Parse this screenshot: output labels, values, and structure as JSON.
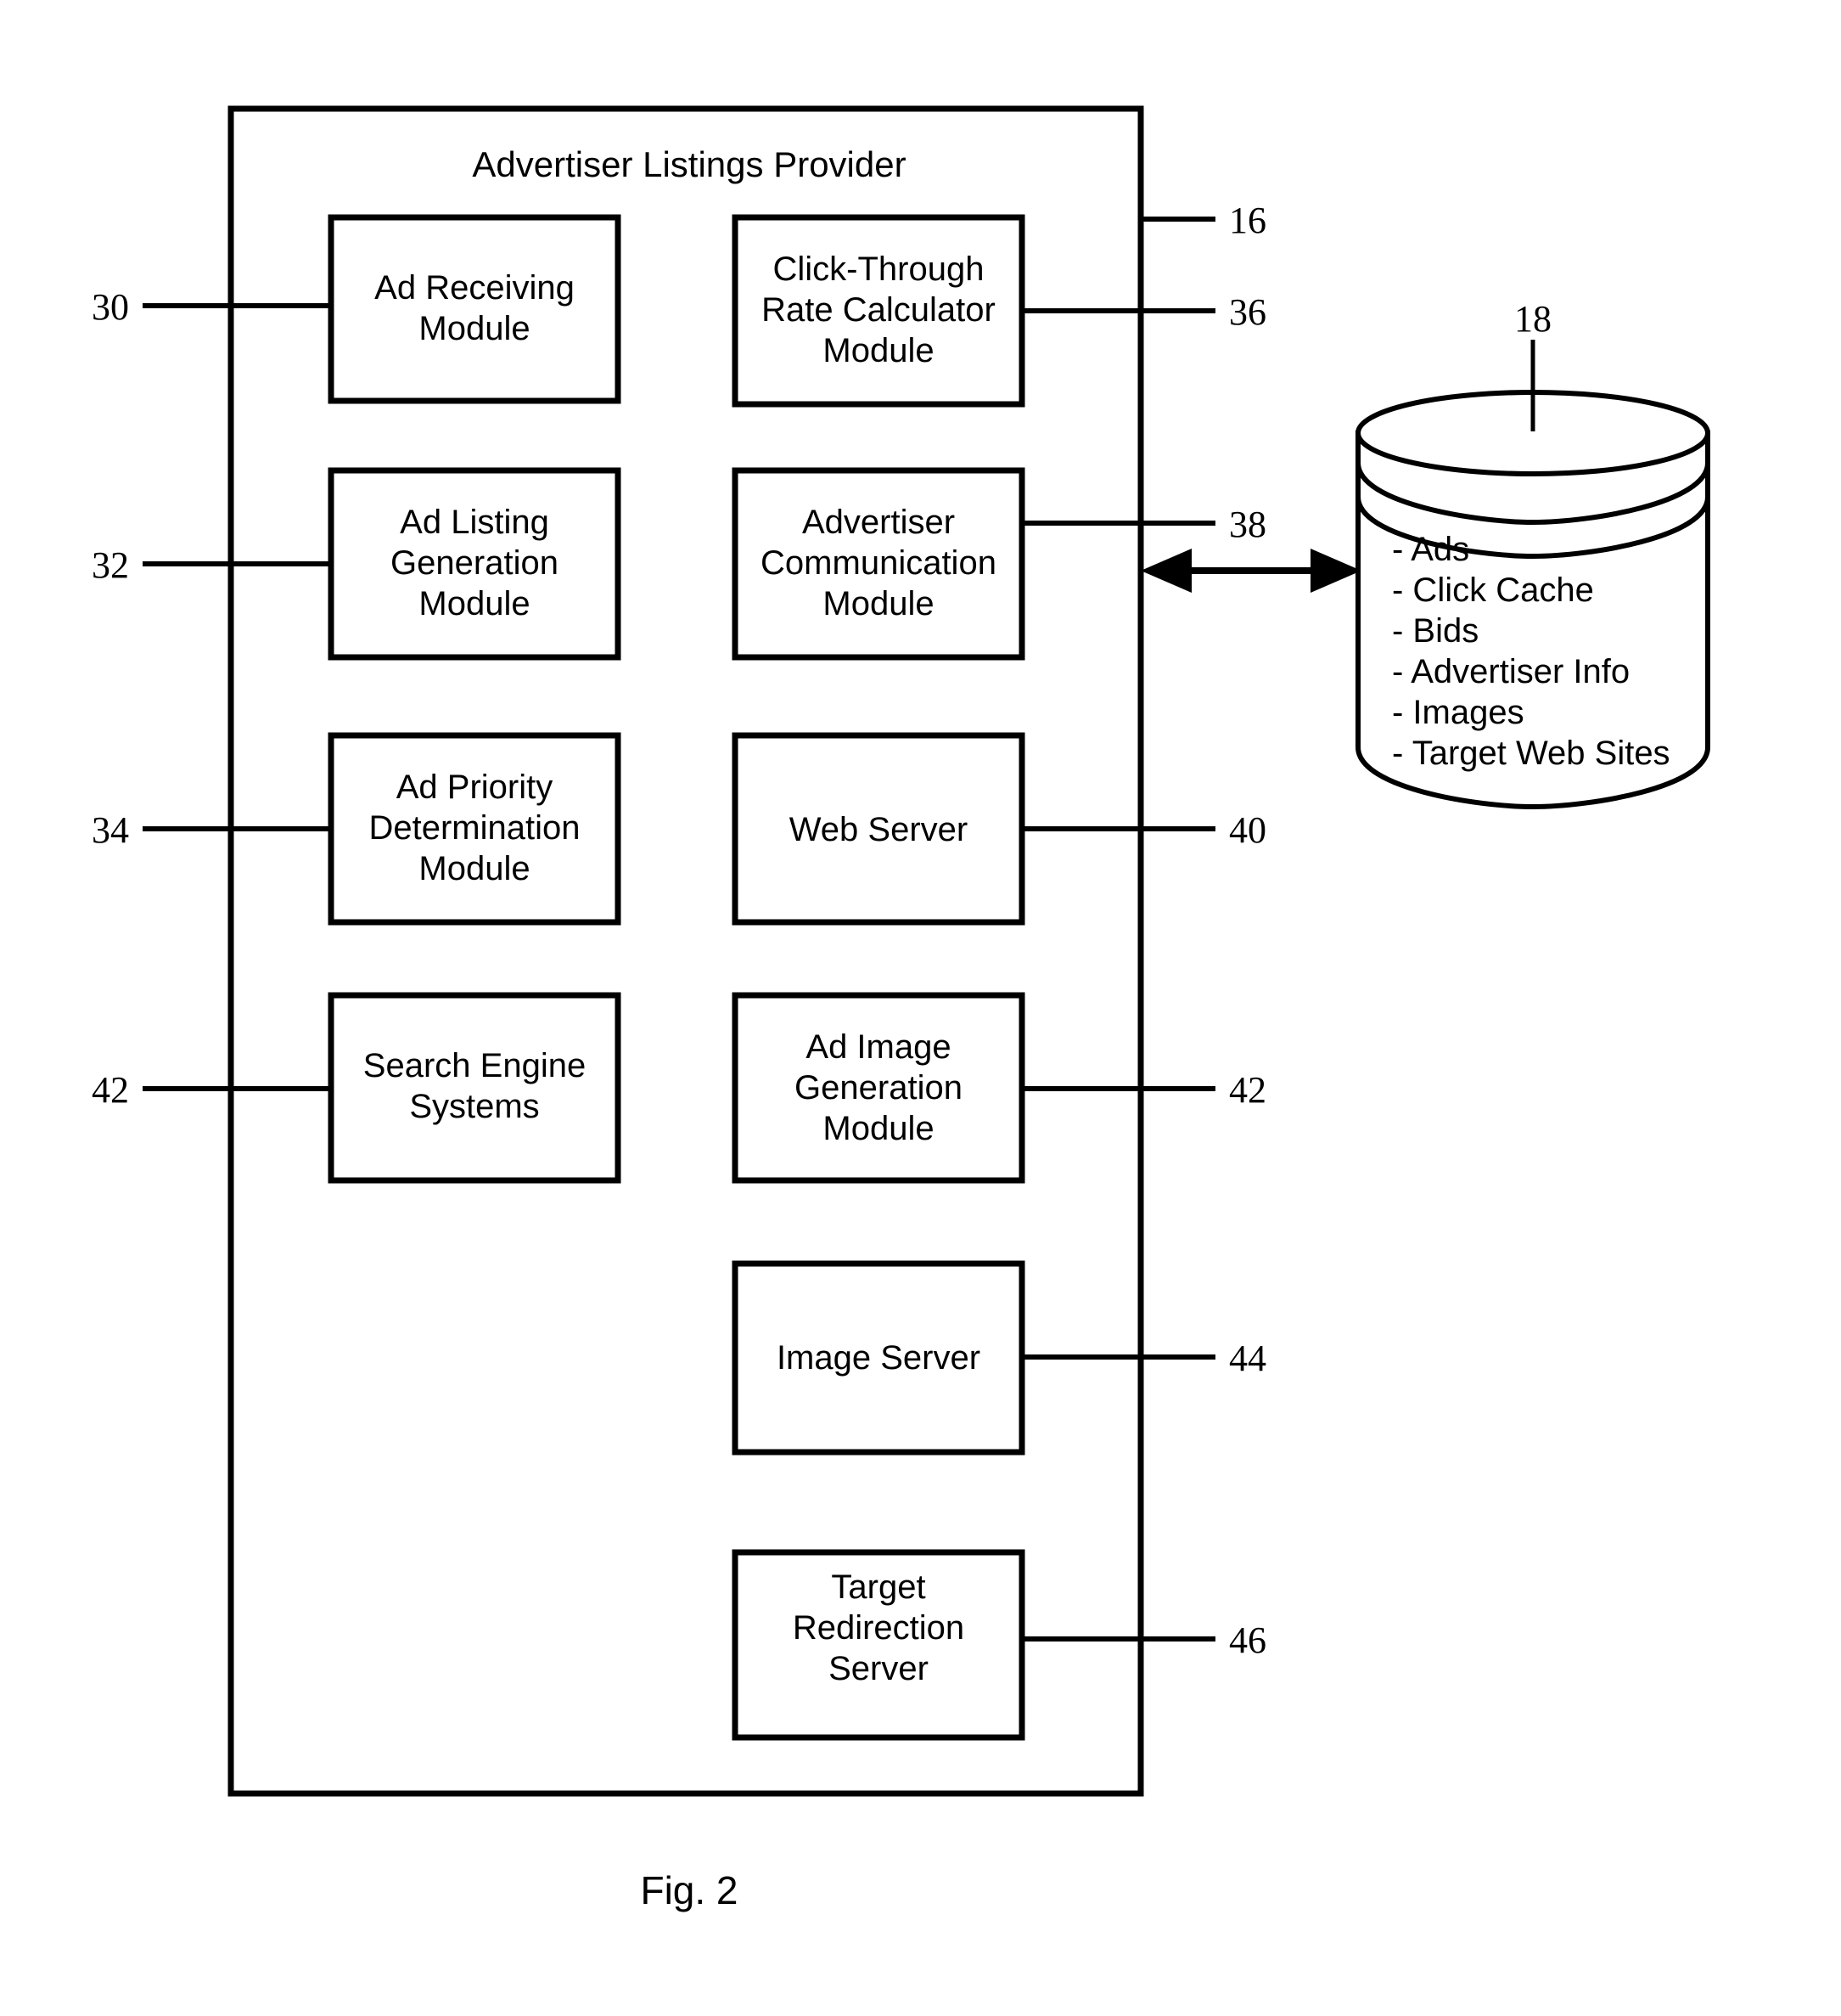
{
  "figure": {
    "caption": "Fig. 2",
    "container_title": "Advertiser Listings Provider",
    "container_ref": "16"
  },
  "modules": {
    "left_column": [
      {
        "label_lines": [
          "Ad Receiving",
          "Module"
        ],
        "ref": "30"
      },
      {
        "label_lines": [
          "Ad Listing",
          "Generation",
          "Module"
        ],
        "ref": "32"
      },
      {
        "label_lines": [
          "Ad Priority",
          "Determination",
          "Module"
        ],
        "ref": "34"
      },
      {
        "label_lines": [
          "Search Engine",
          "Systems"
        ],
        "ref": "42"
      }
    ],
    "right_column": [
      {
        "label_lines": [
          "Click-Through",
          "Rate Calculator",
          "Module"
        ],
        "ref": "36"
      },
      {
        "label_lines": [
          "Advertiser",
          "Communication",
          "Module"
        ],
        "ref": "38"
      },
      {
        "label_lines": [
          "Web Server"
        ],
        "ref": "40"
      },
      {
        "label_lines": [
          "Ad Image",
          "Generation",
          "Module"
        ],
        "ref": "42"
      },
      {
        "label_lines": [
          "Image Server"
        ],
        "ref": "44"
      },
      {
        "label_lines": [
          "Target",
          "Redirection",
          "Server"
        ],
        "ref": "46"
      }
    ]
  },
  "database": {
    "ref": "18",
    "items": [
      "- Ads",
      "- Click Cache",
      "- Bids",
      "- Advertiser Info",
      "- Images",
      "- Target Web Sites"
    ]
  },
  "labels": {
    "m30_l1": "Ad Receiving",
    "m30_l2": "Module",
    "m32_l1": "Ad Listing",
    "m32_l2": "Generation",
    "m32_l3": "Module",
    "m34_l1": "Ad Priority",
    "m34_l2": "Determination",
    "m34_l3": "Module",
    "m42l_l1": "Search Engine",
    "m42l_l2": "Systems",
    "m36_l1": "Click-Through",
    "m36_l2": "Rate Calculator",
    "m36_l3": "Module",
    "m38_l1": "Advertiser",
    "m38_l2": "Communication",
    "m38_l3": "Module",
    "m40_l1": "Web Server",
    "m42r_l1": "Ad Image",
    "m42r_l2": "Generation",
    "m42r_l3": "Module",
    "m44_l1": "Image Server",
    "m46_l1": "Target",
    "m46_l2": "Redirection",
    "m46_l3": "Server"
  },
  "refs": {
    "r16": "16",
    "r18": "18",
    "r30": "30",
    "r32": "32",
    "r34": "34",
    "r36": "36",
    "r38": "38",
    "r40": "40",
    "r42_left": "42",
    "r42_right": "42",
    "r44": "44",
    "r46": "46"
  },
  "db_items": {
    "i0": "- Ads",
    "i1": "- Click Cache",
    "i2": "- Bids",
    "i3": "- Advertiser Info",
    "i4": "- Images",
    "i5": "- Target Web Sites"
  },
  "colors": {
    "stroke": "#000000",
    "background": "#ffffff"
  }
}
